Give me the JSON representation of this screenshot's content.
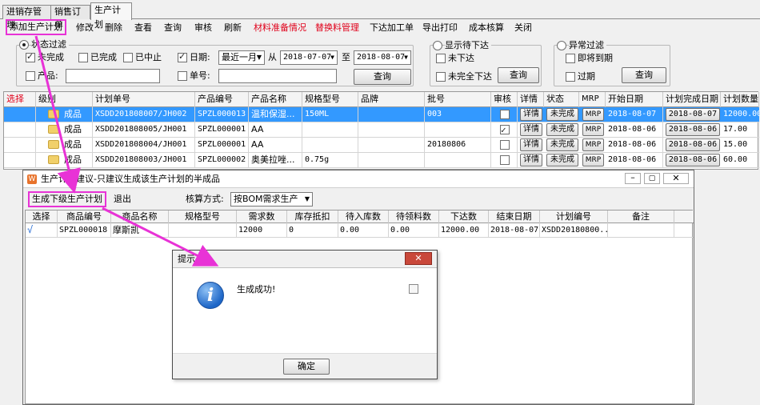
{
  "tabs": [
    "进销存管理",
    "销售订单",
    "生产计划"
  ],
  "toolbar": [
    {
      "label": "添加生产计划",
      "color": "#000000"
    },
    {
      "label": "修改",
      "color": "#000000"
    },
    {
      "label": "删除",
      "color": "#000000"
    },
    {
      "label": "查看",
      "color": "#000000"
    },
    {
      "label": "查询",
      "color": "#000000"
    },
    {
      "label": "审核",
      "color": "#000000"
    },
    {
      "label": "刷新",
      "color": "#000000"
    },
    {
      "label": "材料准备情况",
      "color": "#e0001a"
    },
    {
      "label": "替换料管理",
      "color": "#e0001a"
    },
    {
      "label": "下达加工单",
      "color": "#000000"
    },
    {
      "label": "导出打印",
      "color": "#000000"
    },
    {
      "label": "成本核算",
      "color": "#000000"
    },
    {
      "label": "关闭",
      "color": "#000000"
    }
  ],
  "filters": {
    "status": {
      "title": "状态过滤",
      "uncompleted": "未完成",
      "completed": "已完成",
      "stopped": "已中止",
      "product_label": "产品:",
      "date_label": "日期:",
      "period": "最近一月",
      "from_label": "从",
      "from_date": "2018-07-07",
      "to_label": "至",
      "to_date": "2018-08-07",
      "order_label": "单号:",
      "query": "查询"
    },
    "pending": {
      "title": "显示待下达",
      "not_issued": "未下达",
      "partial": "未完全下达",
      "query": "查询"
    },
    "exception": {
      "title": "异常过滤",
      "near_due": "即将到期",
      "overdue": "过期",
      "query": "查询"
    }
  },
  "grid": {
    "headers": [
      "选择",
      "级别",
      "计划单号",
      "产品编号",
      "产品名称",
      "规格型号",
      "品牌",
      "批号",
      "审核",
      "详情",
      "状态",
      "MRP",
      "开始日期",
      "计划完成日期",
      "计划数量"
    ],
    "header_colors": {
      "select": "#e0001a"
    },
    "rows": [
      {
        "level": "成品",
        "plan_no": "XSDD201808007/JH002",
        "code": "SPZL000013",
        "name": "温和保湿...",
        "spec": "150ML",
        "brand": "",
        "batch": "003",
        "audited": false,
        "detail": "详情",
        "status": "未完成",
        "mrp": "MRP",
        "start": "2018-08-07",
        "finish": "2018-08-07",
        "qty": "12000.00",
        "selected": true
      },
      {
        "level": "成品",
        "plan_no": "XSDD201808005/JH001",
        "code": "SPZL000001",
        "name": "AA",
        "spec": "",
        "brand": "",
        "batch": "",
        "audited": true,
        "detail": "详情",
        "status": "未完成",
        "mrp": "MRP",
        "start": "2018-08-06",
        "finish": "2018-08-06",
        "qty": "17.00",
        "selected": false
      },
      {
        "level": "成品",
        "plan_no": "XSDD201808004/JH001",
        "code": "SPZL000001",
        "name": "AA",
        "spec": "",
        "brand": "",
        "batch": "20180806",
        "audited": false,
        "detail": "详情",
        "status": "未完成",
        "mrp": "MRP",
        "start": "2018-08-06",
        "finish": "2018-08-06",
        "qty": "15.00",
        "selected": false
      },
      {
        "level": "成品",
        "plan_no": "XSDD201808003/JH001",
        "code": "SPZL000002",
        "name": "奥美拉唑...",
        "spec": "0.75g",
        "brand": "",
        "batch": "",
        "audited": false,
        "detail": "详情",
        "status": "未完成",
        "mrp": "MRP",
        "start": "2018-08-06",
        "finish": "2018-08-06",
        "qty": "60.00",
        "selected": false
      }
    ]
  },
  "sub_dialog": {
    "title": "生产计划建议-只建议生成该生产计划的半成品",
    "generate_btn": "生成下级生产计划",
    "exit_btn": "退出",
    "calc_label": "核算方式:",
    "calc_value": "按BOM需求生产",
    "headers": [
      "选择",
      "商品编号",
      "商品名称",
      "规格型号",
      "需求数",
      "库存抵扣",
      "待入库数",
      "待领料数",
      "下达数",
      "结束日期",
      "计划编号",
      "备注"
    ],
    "row": {
      "check": "√",
      "code": "SPZL000018",
      "name": "摩斯凯",
      "spec": "",
      "demand": "12000",
      "stock": "0",
      "pending_in": "0.00",
      "pending_pick": "0.00",
      "issued": "12000.00",
      "end_date": "2018-08-07",
      "plan_no": "XSDD20180800...",
      "remark": ""
    }
  },
  "message_box": {
    "title": "提示",
    "text": "生成成功!",
    "ok": "确定",
    "icon": "info-icon"
  },
  "colors": {
    "highlight": "#e832d6",
    "selected_row": "#3399ff",
    "red_text": "#e0001a"
  }
}
